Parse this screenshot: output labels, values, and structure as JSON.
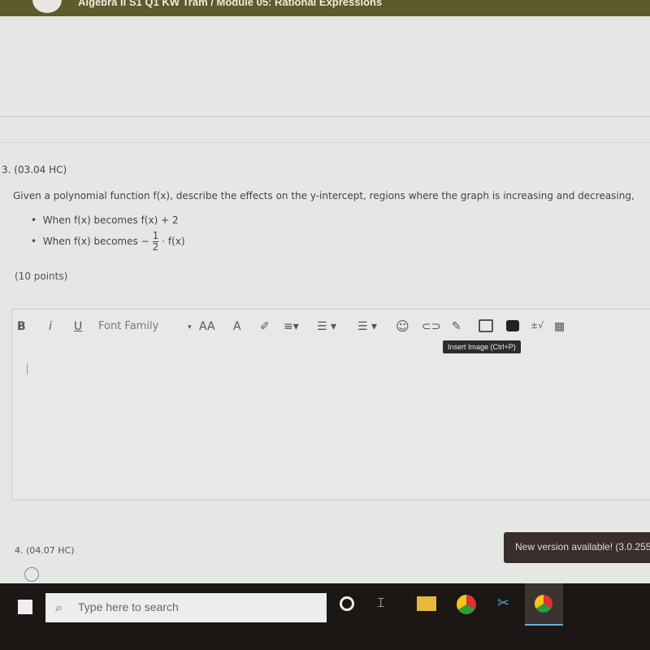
{
  "header": {
    "breadcrumb": "Algebra II S1 Q1 KW Tram / Module 05: Rational Expressions"
  },
  "question": {
    "number": "3. (03.04 HC)",
    "text": "Given a polynomial function f(x), describe the effects on the y-intercept, regions where the graph is increasing and decreasing,",
    "bullet1": "When f(x) becomes f(x) + 2",
    "bullet2_prefix": "When f(x) becomes −",
    "bullet2_num": "1",
    "bullet2_den": "2",
    "bullet2_suffix": "· f(x)",
    "points": "(10 points)"
  },
  "toolbar": {
    "bold": "B",
    "italic": "i",
    "underline": "U",
    "font_family": "Font Family",
    "font_size": "AA",
    "plusminus": "±√",
    "tooltip": "Insert Image (Ctrl+P)"
  },
  "next_question": {
    "number": "4. (04.07 HC)"
  },
  "toast": {
    "text": "New version available! (3.0.255"
  },
  "taskbar": {
    "search_placeholder": "Type here to search"
  }
}
